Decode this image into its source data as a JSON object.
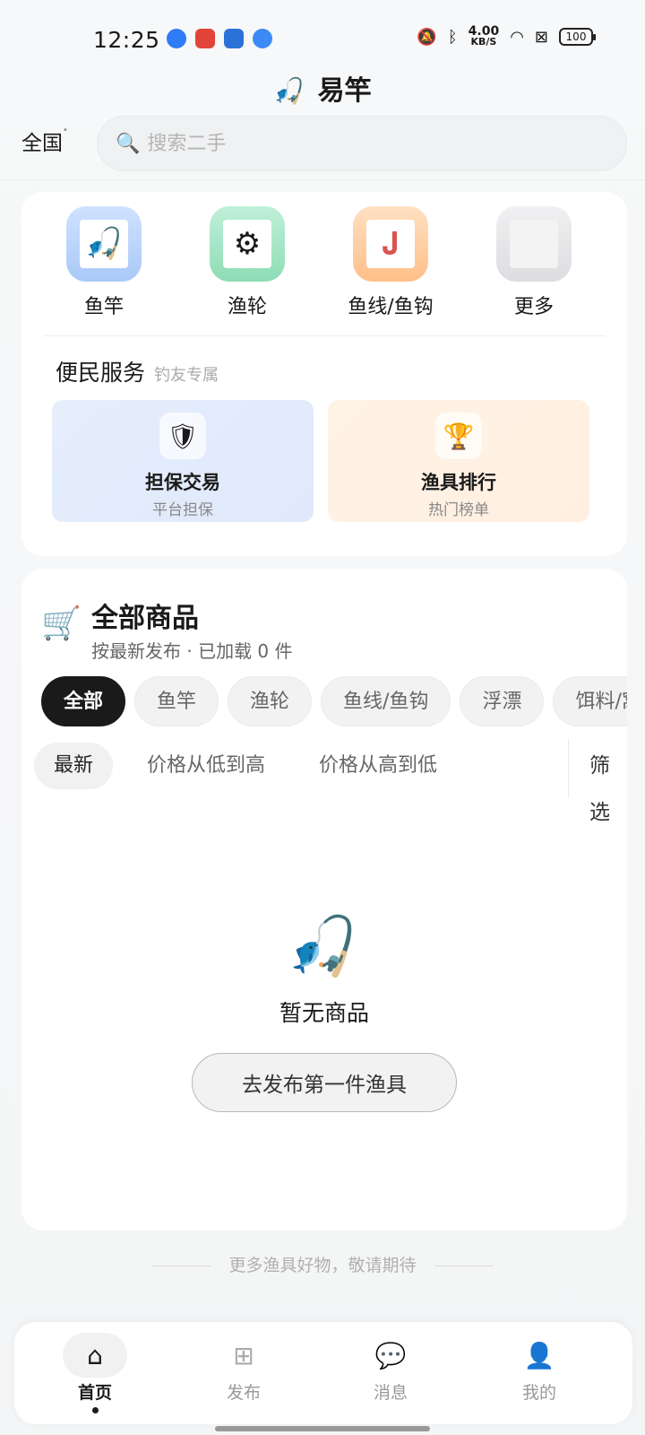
{
  "status_bar": {
    "time": "12:25",
    "net_speed_value": "4.00",
    "net_speed_unit": "KB/S",
    "battery": "100",
    "icons": [
      "mute-bell-icon",
      "bluetooth-icon",
      "wifi-icon",
      "sim-off-icon"
    ]
  },
  "header": {
    "title": "易竿",
    "logo_icon": "fishing-rod-icon",
    "region": "全国",
    "search_placeholder": "搜索二手"
  },
  "categories": [
    {
      "label": "鱼竿",
      "icon": "rod-icon",
      "color": "#a9c9f7"
    },
    {
      "label": "渔轮",
      "icon": "reel-icon",
      "color": "#8fdcb6"
    },
    {
      "label": "鱼线/鱼钩",
      "icon": "hook-icon",
      "color": "#ffbf88"
    },
    {
      "label": "更多",
      "icon": "more-icon",
      "color": "#dcdde0"
    }
  ],
  "services": {
    "title": "便民服务",
    "subtitle": "钓友专属",
    "items": [
      {
        "name": "担保交易",
        "desc": "平台担保",
        "icon": "shield-icon"
      },
      {
        "name": "渔具排行",
        "desc": "热门榜单",
        "icon": "trophy-icon"
      }
    ]
  },
  "products": {
    "title": "全部商品",
    "subtitle": "按最新发布 · 已加载 0 件",
    "chips": [
      "全部",
      "鱼竿",
      "渔轮",
      "鱼线/鱼钩",
      "浮漂",
      "饵料/窝"
    ],
    "sort": [
      "最新",
      "价格从低到高",
      "价格从高到低"
    ],
    "filter_label": "筛选",
    "empty_text": "暂无商品",
    "publish_button": "去发布第一件渔具"
  },
  "footer_note": "更多渔具好物，敬请期待",
  "bottom_nav": [
    {
      "label": "首页",
      "icon": "home-icon",
      "active": true
    },
    {
      "label": "发布",
      "icon": "plus-square-icon",
      "active": false
    },
    {
      "label": "消息",
      "icon": "chat-bubble-icon",
      "active": false
    },
    {
      "label": "我的",
      "icon": "user-icon",
      "active": false
    }
  ],
  "colors": {
    "accent": "#1a1a1a",
    "escrow_bg": "#e3ecfb",
    "rank_bg": "#fff1e3"
  }
}
